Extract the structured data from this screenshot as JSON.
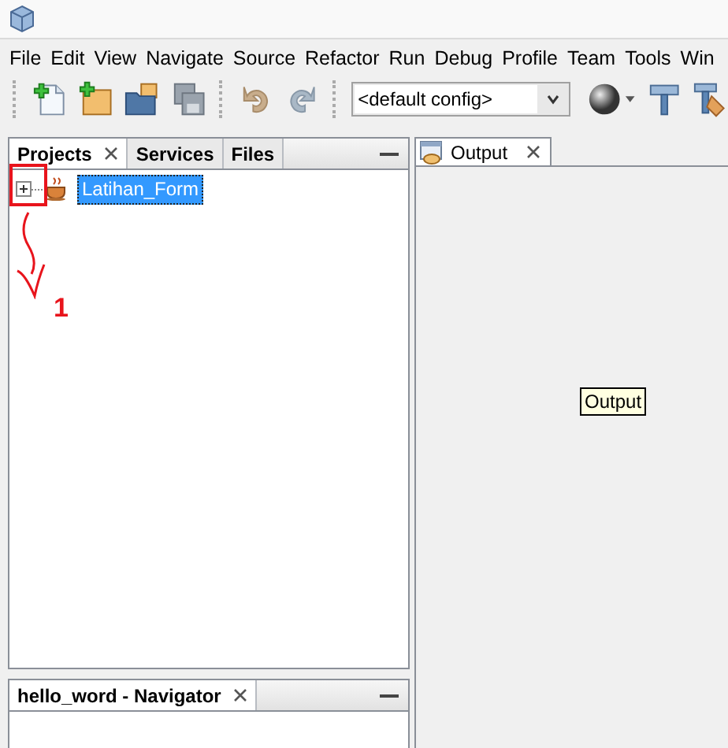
{
  "menu": [
    "File",
    "Edit",
    "View",
    "Navigate",
    "Source",
    "Refactor",
    "Run",
    "Debug",
    "Profile",
    "Team",
    "Tools",
    "Win"
  ],
  "toolbar": {
    "config": {
      "value": "<default config>"
    }
  },
  "projects_panel": {
    "tabs": [
      {
        "label": "Projects",
        "selected": true,
        "closable": true
      },
      {
        "label": "Services",
        "selected": false,
        "closable": false
      },
      {
        "label": "Files",
        "selected": false,
        "closable": false
      }
    ],
    "tree": [
      {
        "label": "Latihan_Form",
        "selected": true,
        "expanded": false
      }
    ]
  },
  "annotation": {
    "label": "1"
  },
  "navigator_panel": {
    "tabs": [
      {
        "label": "hello_word - Navigator",
        "selected": true,
        "closable": true
      }
    ]
  },
  "output_panel": {
    "tabs": [
      {
        "label": "Output",
        "selected": true,
        "closable": true
      }
    ],
    "tooltip": "Output"
  }
}
